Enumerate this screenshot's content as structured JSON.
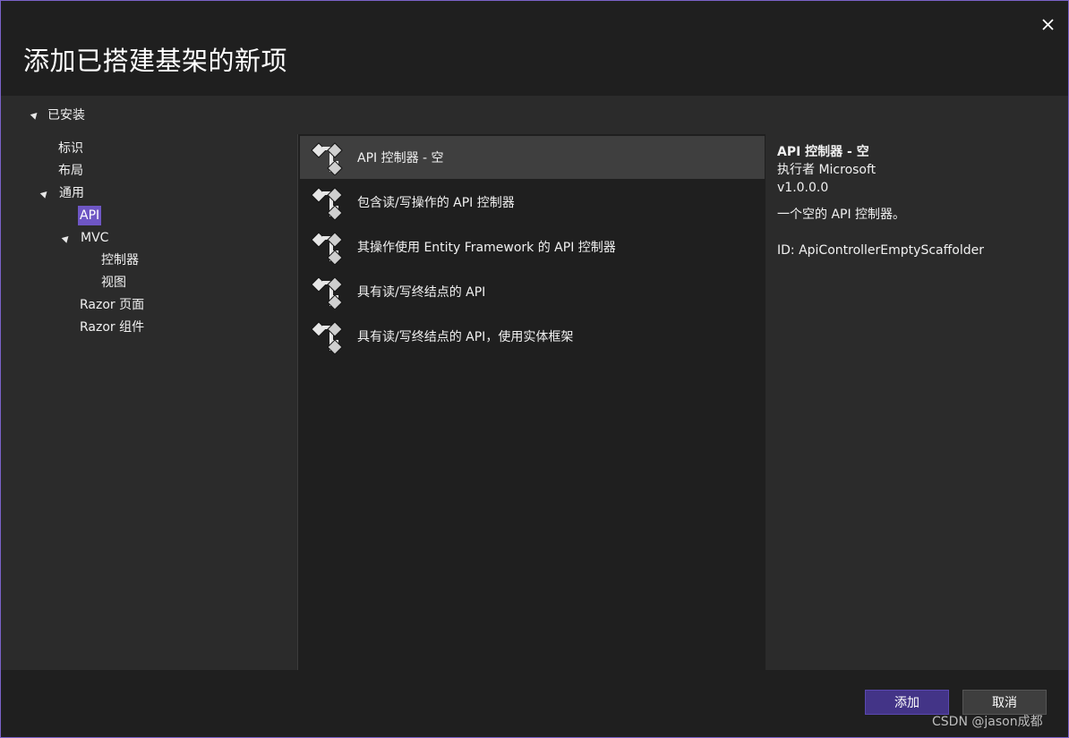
{
  "dialog": {
    "title": "添加已搭建基架的新项",
    "close_icon": "close-icon"
  },
  "tree": {
    "header": "已安装",
    "items": [
      {
        "label": "标识"
      },
      {
        "label": "布局"
      },
      {
        "label": "通用"
      },
      {
        "label": "API",
        "selected": true
      },
      {
        "label": "MVC"
      },
      {
        "label": "控制器"
      },
      {
        "label": "视图"
      },
      {
        "label": "Razor 页面"
      },
      {
        "label": "Razor 组件"
      }
    ]
  },
  "templates": [
    {
      "label": "API 控制器 - 空",
      "selected": true,
      "icon": "scaffold-icon"
    },
    {
      "label": "包含读/写操作的 API 控制器",
      "icon": "scaffold-icon"
    },
    {
      "label": "其操作使用 Entity Framework 的 API 控制器",
      "icon": "scaffold-icon"
    },
    {
      "label": "具有读/写终结点的 API",
      "icon": "scaffold-icon"
    },
    {
      "label": "具有读/写终结点的 API，使用实体框架",
      "icon": "scaffold-icon"
    }
  ],
  "detail": {
    "title": "API 控制器 - 空",
    "author": "执行者 Microsoft",
    "version": "v1.0.0.0",
    "description": "一个空的 API 控制器。",
    "id": "ID: ApiControllerEmptyScaffolder"
  },
  "buttons": {
    "add": "添加",
    "cancel": "取消"
  },
  "watermark": "CSDN @jason成都",
  "colors": {
    "accent": "#6e56c4",
    "primary_button": "#433487",
    "background": "#1f1f1f",
    "panel": "#2b2b2b"
  }
}
